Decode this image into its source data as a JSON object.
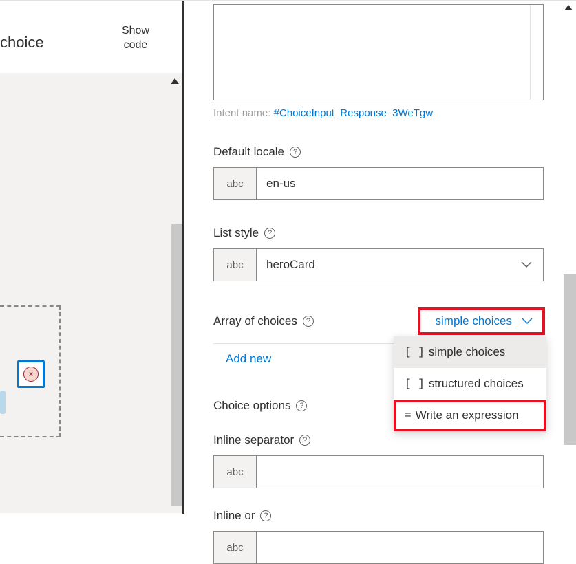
{
  "leftPanel": {
    "tabLabel": "choice",
    "showCode": "Show\ncode"
  },
  "intent": {
    "label": "Intent name: ",
    "value": "#ChoiceInput_Response_3WeTgw"
  },
  "defaultLocale": {
    "label": "Default locale",
    "prefix": "abc",
    "value": "en-us"
  },
  "listStyle": {
    "label": "List style",
    "prefix": "abc",
    "value": "heroCard"
  },
  "arrayOfChoices": {
    "label": "Array of choices",
    "buttonLabel": "simple choices",
    "addNew": "Add new",
    "options": [
      {
        "icon": "[ ]",
        "label": "simple choices"
      },
      {
        "icon": "[ ]",
        "label": "structured choices"
      },
      {
        "icon": "=",
        "label": "Write an expression"
      }
    ]
  },
  "choiceOptions": {
    "label": "Choice options"
  },
  "inlineSeparator": {
    "label": "Inline separator",
    "prefix": "abc",
    "value": ""
  },
  "inlineOr": {
    "label": "Inline or",
    "prefix": "abc",
    "value": ""
  }
}
